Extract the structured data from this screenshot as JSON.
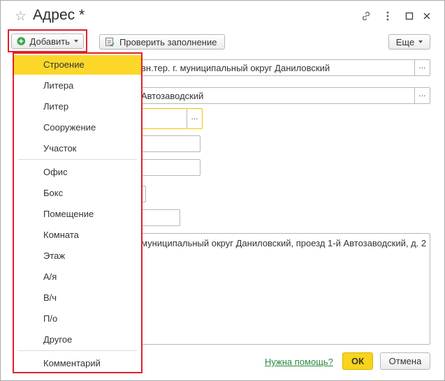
{
  "window": {
    "title": "Адрес *",
    "favorite_icon": "star-icon",
    "link_icon": "link-icon",
    "more_icon": "vertical-dots-icon",
    "maximize_icon": "maximize-icon",
    "close_icon": "close-icon"
  },
  "toolbar": {
    "add_label": "Добавить",
    "check_label": "Проверить заполнение",
    "more_label": "Еще"
  },
  "form": {
    "field1": "вн.тер. г. муниципальный округ Даниловский",
    "field2": "Автозаводский",
    "ellipsis": "...",
    "address_text": "муниципальный округ Даниловский, проезд 1-й Автозаводский, д. 2"
  },
  "menu": {
    "items": [
      "Строение",
      "Литера",
      "Литер",
      "Сооружение",
      "Участок",
      "Офис",
      "Бокс",
      "Помещение",
      "Комната",
      "Этаж",
      "А/я",
      "В/ч",
      "П/о",
      "Другое",
      "Комментарий"
    ]
  },
  "footer": {
    "help_link": "Нужна помощь?",
    "ok_label": "ОК",
    "cancel_label": "Отмена"
  },
  "colors": {
    "highlight_red": "#e0202b",
    "active_yellow": "#fcd72a",
    "ok_yellow": "#f9d41c",
    "help_green": "#2b8a3e"
  }
}
